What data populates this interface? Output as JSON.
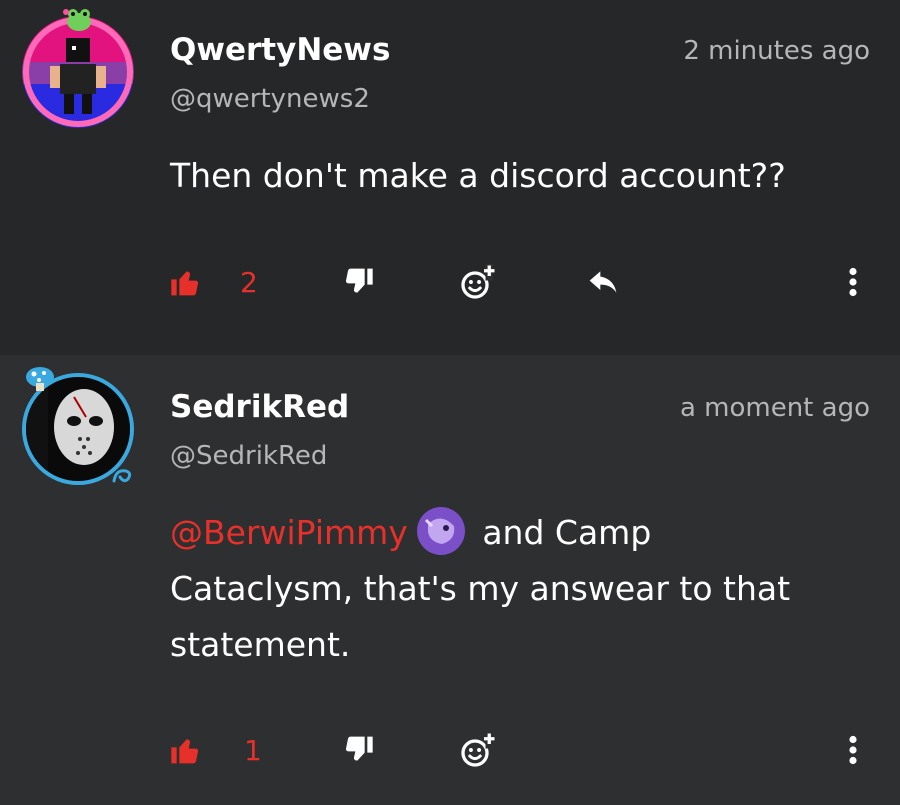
{
  "comments": [
    {
      "username": "QwertyNews",
      "handle": "@qwertynews2",
      "time": "2 minutes ago",
      "text": "Then don't make a discord account??",
      "likes": "2",
      "liked": true
    },
    {
      "username": "SedrikRed",
      "handle": "@SedrikRed",
      "time": "a moment ago",
      "mention": "@BerwiPimmy",
      "text_after_mention": " and Camp",
      "text_line2": "Cataclysm, that's my answear to that",
      "text_line3": "statement.",
      "likes": "1",
      "liked": true
    }
  ],
  "icons": {
    "like": "thumbs-up-icon",
    "dislike": "thumbs-down-icon",
    "add_reaction": "add-reaction-icon",
    "reply": "reply-icon",
    "more": "more-vertical-icon"
  },
  "colors": {
    "accent": "#e8302b",
    "background": "#252729",
    "background_alt": "#2d2f31",
    "muted_text": "#b4b6b8"
  }
}
